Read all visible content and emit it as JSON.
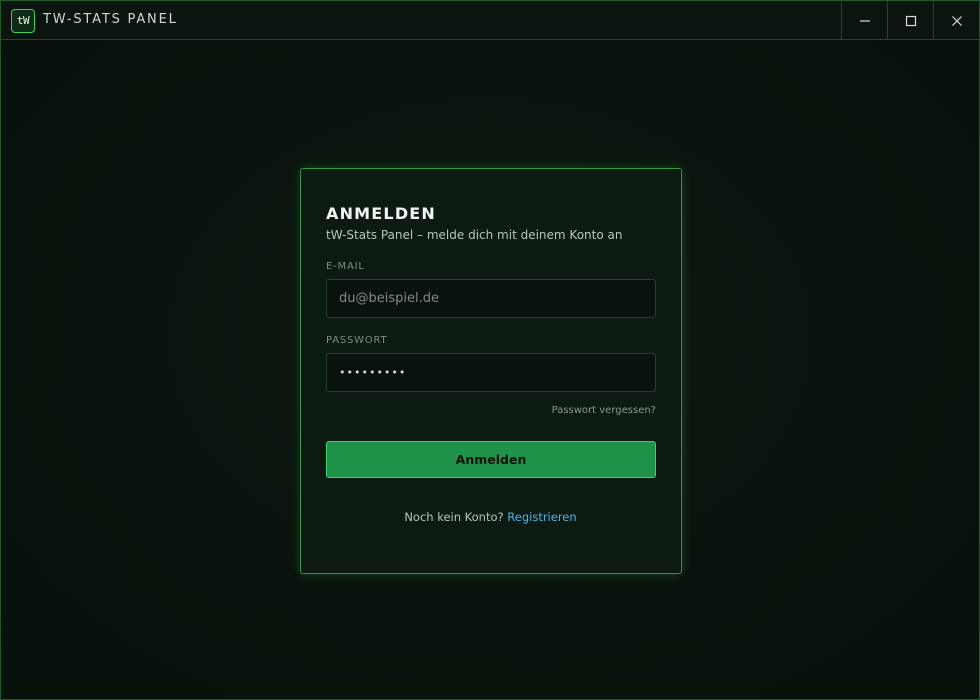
{
  "window": {
    "logo_text": "tW",
    "title": "TW-STATS PANEL",
    "controls": {
      "minimize": "minimize-icon",
      "maximize": "maximize-icon",
      "close": "close-icon"
    }
  },
  "login": {
    "title": "ANMELDEN",
    "subtitle": "tW-Stats Panel – melde dich mit deinem Konto an",
    "email": {
      "label": "E-MAIL",
      "placeholder": "du@beispiel.de",
      "value": ""
    },
    "password": {
      "label": "PASSWORT",
      "masked_value": "•••••••••"
    },
    "forgot_label": "Passwort vergessen?",
    "submit_label": "Anmelden",
    "no_account_text": "Noch kein Konto?",
    "register_label": "Registrieren"
  },
  "colors": {
    "accent": "#37d45e",
    "button_bg": "#1f924a",
    "link": "#4fb3ea",
    "background": "#0a120d"
  }
}
